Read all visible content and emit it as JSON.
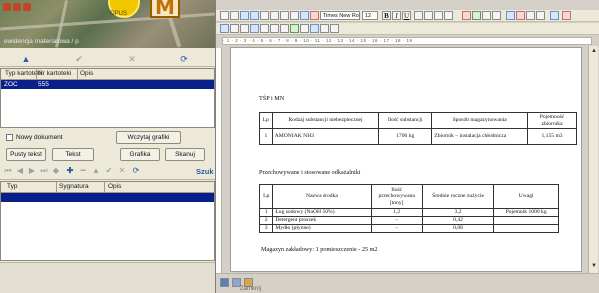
{
  "map": {
    "pin_caption": "OPUS",
    "marker_letter": "M",
    "panel_caption": "ewidencja materiałowa / p"
  },
  "kartoteki": {
    "toolbar": {
      "up": "▲",
      "check": "✔",
      "cancel": "✕",
      "refresh": "⟳"
    },
    "columns": [
      "Typ kartoteki",
      "Nr kartoteki",
      "Opis"
    ],
    "rows": [
      {
        "typ": "ZOC",
        "nr": "555",
        "opis": ""
      }
    ]
  },
  "actions": {
    "new_doc_label": "Nowy dokument",
    "load_graphics": "Wczytaj grafiki",
    "empty_text": "Pusty tekst",
    "text": "Tekst",
    "graphics": "Grafika",
    "scan": "Skanuj"
  },
  "documents": {
    "toolbar_search": "Szuk",
    "columns": [
      "Typ",
      "Sygnatura",
      "Opis"
    ],
    "rows": [
      {
        "typ": "",
        "sygnatura": "",
        "opis": ""
      }
    ]
  },
  "editor": {
    "font_name": "Times New Roman",
    "font_size": "12",
    "ruler_marks": "· 1 · 2 · 3 · 4 · 5 · 6 · 7 · 8 · 9 · 10 · 11 · 12 · 13 · 14 · 15 · 16 · 17 · 18 · 19",
    "document": {
      "heading": "TŚP i MN",
      "table1": {
        "headers": [
          "Lp",
          "Rodzaj substancji niebezpiecznej",
          "Ilość substancji",
          "Sposób magazynowania",
          "Pojemność zbiornika"
        ],
        "rows": [
          [
            "1",
            "AMONIAK NH3",
            "1700 kg",
            "Zbiornik – instalacja chłodnicza",
            "1,155 m3"
          ]
        ]
      },
      "section2": "Przechowywane i stosowane odkażalniki",
      "table2": {
        "headers": [
          "Lp",
          "Nazwa środka",
          "Ilość przechowywana [tony]",
          "Średnie roczne zużycie",
          "Uwagi"
        ],
        "rows": [
          [
            "1",
            "Ług sodowy (NaOH 50%)",
            "1,2",
            "3,2",
            "Pojemnik 1000 kg"
          ],
          [
            "2",
            "Detergent proszek",
            "-",
            "0,42",
            ""
          ],
          [
            "3",
            "Mydło (płynne)",
            "-",
            "0,08",
            ""
          ]
        ]
      },
      "footer": "Magazyn zakładowy: 1 pomieszczenie - 25 m2"
    }
  },
  "taskbar": {
    "label": "Zamknij"
  }
}
